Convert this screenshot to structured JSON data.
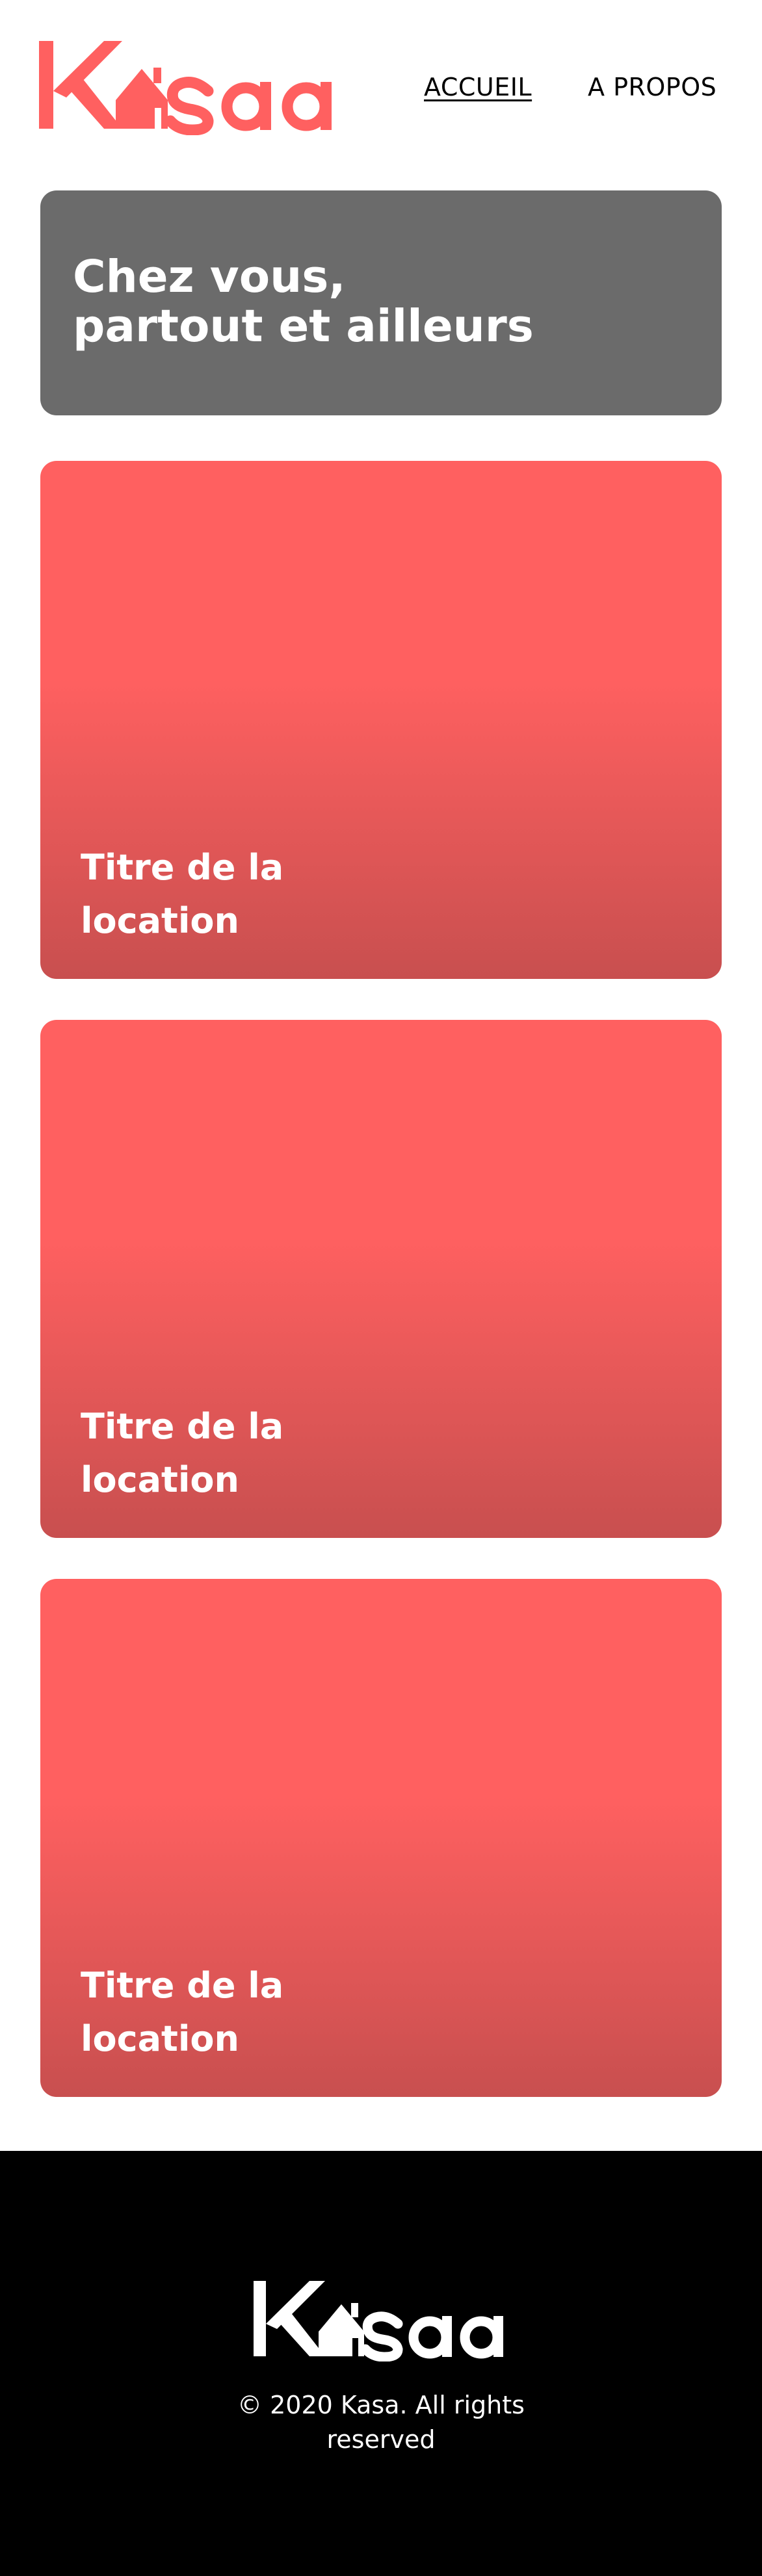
{
  "brand": {
    "name": "Kasa",
    "accent_color": "#ff6060",
    "logo_icon": "house-icon"
  },
  "nav": {
    "home_label": "ACCUEIL",
    "about_label": "A PROPOS"
  },
  "banner": {
    "title": "Chez vous,\npartout et ailleurs"
  },
  "cards": [
    {
      "title": "Titre de la location"
    },
    {
      "title": "Titre de la location"
    },
    {
      "title": "Titre de la location"
    }
  ],
  "footer": {
    "copyright": "© 2020 Kasa. All rights reserved"
  }
}
